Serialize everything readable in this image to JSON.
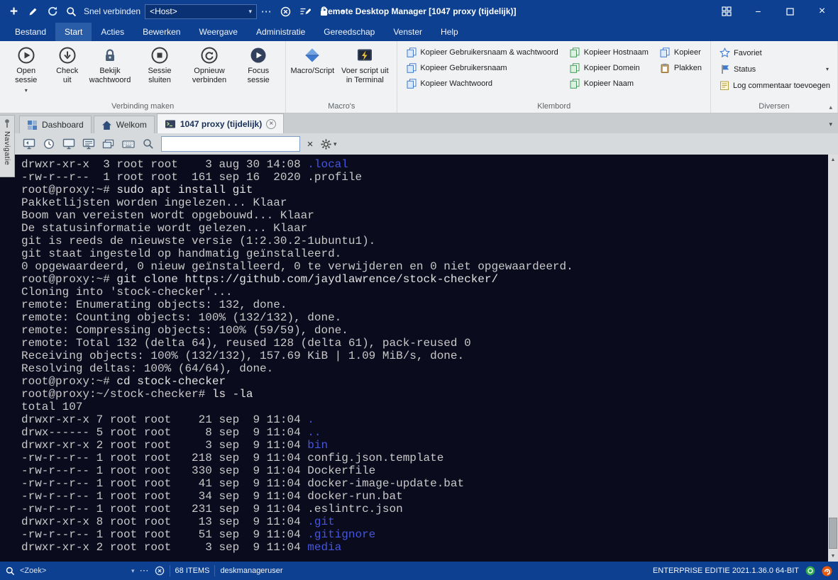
{
  "icons": {
    "plus": "+",
    "minus": "−",
    "close": "×",
    "more": "⋯",
    "chevron_down": "▾",
    "collapse": "▴",
    "scroll_up": "▲",
    "scroll_down": "▼"
  },
  "titlebar": {
    "quick_connect_label": "Snel verbinden",
    "host_value": "<Host>",
    "title": "Remote Desktop Manager [1047 proxy (tijdelijk)]"
  },
  "menu": {
    "items": [
      "Bestand",
      "Start",
      "Acties",
      "Bewerken",
      "Weergave",
      "Administratie",
      "Gereedschap",
      "Venster",
      "Help"
    ],
    "active_index": 1
  },
  "ribbon": {
    "groups": [
      {
        "label": "Verbinding maken"
      },
      {
        "label": "Macro's"
      },
      {
        "label": "Klembord"
      },
      {
        "label": "Diversen"
      }
    ],
    "buttons": {
      "open_session": "Open sessie",
      "check_out": "Check uit",
      "view_password": "Bekijk wachtwoord",
      "close_session": "Sessie sluiten",
      "reconnect": "Opnieuw verbinden",
      "focus_session": "Focus sessie",
      "macro_script": "Macro/Script",
      "run_script_terminal": "Voer script uit in Terminal",
      "copy_user_pass": "Kopieer Gebruikersnaam & wachtwoord",
      "copy_username": "Kopieer Gebruikersnaam",
      "copy_password": "Kopieer Wachtwoord",
      "copy_hostname": "Kopieer Hostnaam",
      "copy_domain": "Kopieer Domein",
      "copy_name": "Kopieer Naam",
      "copy": "Kopieer",
      "paste": "Plakken",
      "favorite": "Favoriet",
      "status": "Status",
      "log_comment": "Log commentaar toevoegen"
    }
  },
  "tabs": [
    {
      "label": "Dashboard",
      "active": false
    },
    {
      "label": "Welkom",
      "active": false
    },
    {
      "label": "1047 proxy (tijdelijk)",
      "active": true,
      "closable": true
    }
  ],
  "sidebar": {
    "label": "Navigatie"
  },
  "toolbar": {
    "search_value": ""
  },
  "terminal": {
    "colors": {
      "bg": "#0b0b1e",
      "fg": "#c9c9c9",
      "cmd": "#e2e2e2",
      "dir": "#4456db"
    },
    "lines": [
      [
        {
          "t": "drwxr-xr-x  3 root root    3 aug 30 14:08 ",
          "c": "fg"
        },
        {
          "t": ".local",
          "c": "dir"
        }
      ],
      [
        {
          "t": "-rw-r--r--  1 root root  161 sep 16  2020 .profile",
          "c": "fg"
        }
      ],
      [
        {
          "t": "root@proxy:~# ",
          "c": "fg"
        },
        {
          "t": "sudo apt install git",
          "c": "cmd"
        }
      ],
      [
        {
          "t": "Pakketlijsten worden ingelezen... Klaar",
          "c": "fg"
        }
      ],
      [
        {
          "t": "Boom van vereisten wordt opgebouwd... Klaar",
          "c": "fg"
        }
      ],
      [
        {
          "t": "De statusinformatie wordt gelezen... Klaar",
          "c": "fg"
        }
      ],
      [
        {
          "t": "git is reeds de nieuwste versie (1:2.30.2-1ubuntu1).",
          "c": "fg"
        }
      ],
      [
        {
          "t": "git staat ingesteld op handmatig geïnstalleerd.",
          "c": "fg"
        }
      ],
      [
        {
          "t": "0 opgewaardeerd, 0 nieuw geïnstalleerd, 0 te verwijderen en 0 niet opgewaardeerd.",
          "c": "fg"
        }
      ],
      [
        {
          "t": "root@proxy:~# ",
          "c": "fg"
        },
        {
          "t": "git clone https://github.com/jaydlawrence/stock-checker/",
          "c": "cmd"
        }
      ],
      [
        {
          "t": "Cloning into 'stock-checker'...",
          "c": "fg"
        }
      ],
      [
        {
          "t": "remote: Enumerating objects: 132, done.",
          "c": "fg"
        }
      ],
      [
        {
          "t": "remote: Counting objects: 100% (132/132), done.",
          "c": "fg"
        }
      ],
      [
        {
          "t": "remote: Compressing objects: 100% (59/59), done.",
          "c": "fg"
        }
      ],
      [
        {
          "t": "remote: Total 132 (delta 64), reused 128 (delta 61), pack-reused 0",
          "c": "fg"
        }
      ],
      [
        {
          "t": "Receiving objects: 100% (132/132), 157.69 KiB | 1.09 MiB/s, done.",
          "c": "fg"
        }
      ],
      [
        {
          "t": "Resolving deltas: 100% (64/64), done.",
          "c": "fg"
        }
      ],
      [
        {
          "t": "root@proxy:~# ",
          "c": "fg"
        },
        {
          "t": "cd stock-checker",
          "c": "cmd"
        }
      ],
      [
        {
          "t": "root@proxy:~/stock-checker# ",
          "c": "fg"
        },
        {
          "t": "ls -la",
          "c": "cmd"
        }
      ],
      [
        {
          "t": "total 107",
          "c": "fg"
        }
      ],
      [
        {
          "t": "drwxr-xr-x 7 root root    21 sep  9 11:04 ",
          "c": "fg"
        },
        {
          "t": ".",
          "c": "dir"
        }
      ],
      [
        {
          "t": "drwx------ 5 root root     8 sep  9 11:04 ",
          "c": "fg"
        },
        {
          "t": "..",
          "c": "dir"
        }
      ],
      [
        {
          "t": "drwxr-xr-x 2 root root     3 sep  9 11:04 ",
          "c": "fg"
        },
        {
          "t": "bin",
          "c": "dir"
        }
      ],
      [
        {
          "t": "-rw-r--r-- 1 root root   218 sep  9 11:04 config.json.template",
          "c": "fg"
        }
      ],
      [
        {
          "t": "-rw-r--r-- 1 root root   330 sep  9 11:04 Dockerfile",
          "c": "fg"
        }
      ],
      [
        {
          "t": "-rw-r--r-- 1 root root    41 sep  9 11:04 docker-image-update.bat",
          "c": "fg"
        }
      ],
      [
        {
          "t": "-rw-r--r-- 1 root root    34 sep  9 11:04 docker-run.bat",
          "c": "fg"
        }
      ],
      [
        {
          "t": "-rw-r--r-- 1 root root   231 sep  9 11:04 .eslintrc.json",
          "c": "fg"
        }
      ],
      [
        {
          "t": "drwxr-xr-x 8 root root    13 sep  9 11:04 ",
          "c": "fg"
        },
        {
          "t": ".git",
          "c": "dir"
        }
      ],
      [
        {
          "t": "-rw-r--r-- 1 root root    51 sep  9 11:04 ",
          "c": "fg"
        },
        {
          "t": ".gitignore",
          "c": "dir"
        }
      ],
      [
        {
          "t": "drwxr-xr-x 2 root root     3 sep  9 11:04 ",
          "c": "fg"
        },
        {
          "t": "media",
          "c": "dir"
        }
      ]
    ]
  },
  "statusbar": {
    "search_placeholder": "<Zoek>",
    "items_count": "68 ITEMS",
    "username": "deskmanageruser",
    "edition": "ENTERPRISE EDITIE 2021.1.36.0 64-BIT"
  }
}
